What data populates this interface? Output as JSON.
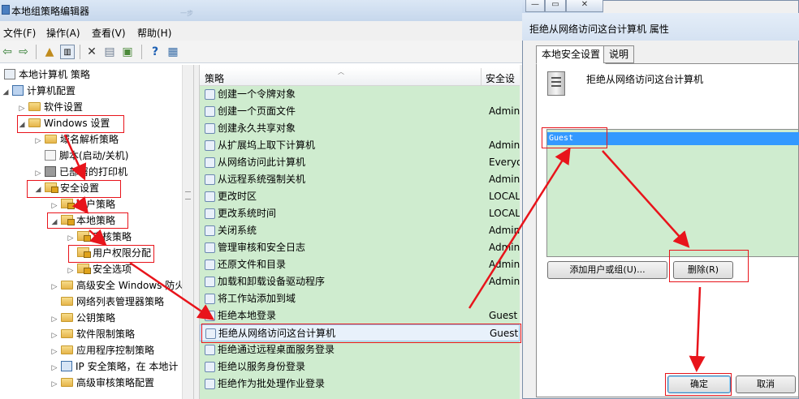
{
  "main_window": {
    "title": "本地组策略编辑器",
    "faded_hint": "一步"
  },
  "menubar": {
    "items": [
      "文件(F)",
      "操作(A)",
      "查看(V)",
      "帮助(H)"
    ]
  },
  "toolbar": {
    "icons": [
      "back-arrow-icon",
      "forward-arrow-icon",
      "up-folder-icon",
      "show-tree-icon",
      "delete-x-icon",
      "properties-icon",
      "export-list-icon",
      "help-icon",
      "extended-view-icon"
    ]
  },
  "tree": {
    "items": [
      {
        "label": "本地计算机 策略",
        "icon": "computer-policy-icon",
        "expand": ""
      },
      {
        "label": "计算机配置",
        "icon": "computer-icon",
        "expand": "open"
      },
      {
        "label": "软件设置",
        "icon": "folder-icon",
        "expand": "closed"
      },
      {
        "label": "Windows 设置",
        "icon": "folder-icon",
        "expand": "open"
      },
      {
        "label": "域名解析策略",
        "icon": "folder-icon",
        "expand": "closed"
      },
      {
        "label": "脚本(启动/关机)",
        "icon": "script-icon",
        "expand": ""
      },
      {
        "label": "已部署的打印机",
        "icon": "printer-icon",
        "expand": "closed"
      },
      {
        "label": "安全设置",
        "icon": "security-folder-icon",
        "expand": "open"
      },
      {
        "label": "帐户策略",
        "icon": "lock-folder-icon",
        "expand": "closed"
      },
      {
        "label": "本地策略",
        "icon": "lock-folder-icon",
        "expand": "open"
      },
      {
        "label": "审核策略",
        "icon": "lock-folder-icon",
        "expand": "closed"
      },
      {
        "label": "用户权限分配",
        "icon": "lock-folder-icon",
        "expand": ""
      },
      {
        "label": "安全选项",
        "icon": "lock-folder-icon",
        "expand": "closed"
      },
      {
        "label": "高级安全 Windows 防火",
        "icon": "folder-icon",
        "expand": "closed"
      },
      {
        "label": "网络列表管理器策略",
        "icon": "folder-icon",
        "expand": ""
      },
      {
        "label": "公钥策略",
        "icon": "folder-icon",
        "expand": "closed"
      },
      {
        "label": "软件限制策略",
        "icon": "folder-icon",
        "expand": "closed"
      },
      {
        "label": "应用程序控制策略",
        "icon": "folder-icon",
        "expand": "closed"
      },
      {
        "label": "IP 安全策略，在 本地计",
        "icon": "ip-security-icon",
        "expand": "closed"
      },
      {
        "label": "高级审核策略配置",
        "icon": "folder-icon",
        "expand": "closed"
      }
    ]
  },
  "list": {
    "col_policy": "策略",
    "col_setting": "安全设置",
    "rows": [
      {
        "name": "创建一个令牌对象",
        "value": ""
      },
      {
        "name": "创建一个页面文件",
        "value": "Adminis"
      },
      {
        "name": "创建永久共享对象",
        "value": ""
      },
      {
        "name": "从扩展坞上取下计算机",
        "value": "Adminis"
      },
      {
        "name": "从网络访问此计算机",
        "value": "Everyon"
      },
      {
        "name": "从远程系统强制关机",
        "value": "Adminis"
      },
      {
        "name": "更改时区",
        "value": "LOCAL S"
      },
      {
        "name": "更改系统时间",
        "value": "LOCAL S"
      },
      {
        "name": "关闭系统",
        "value": "Adminis"
      },
      {
        "name": "管理审核和安全日志",
        "value": "Adminis"
      },
      {
        "name": "还原文件和目录",
        "value": "Adminis"
      },
      {
        "name": "加载和卸载设备驱动程序",
        "value": "Adminis"
      },
      {
        "name": "将工作站添加到域",
        "value": ""
      },
      {
        "name": "拒绝本地登录",
        "value": "Guest"
      },
      {
        "name": "拒绝从网络访问这台计算机",
        "value": "Guest"
      },
      {
        "name": "拒绝通过远程桌面服务登录",
        "value": ""
      },
      {
        "name": "拒绝以服务身份登录",
        "value": ""
      },
      {
        "name": "拒绝作为批处理作业登录",
        "value": ""
      }
    ]
  },
  "dialog": {
    "title": "拒绝从网络访问这台计算机 属性",
    "window_buttons": [
      "minimize-icon",
      "restore-icon",
      "close-icon"
    ],
    "tabs": [
      "本地安全设置",
      "说明"
    ],
    "policy_heading": "拒绝从网络访问这台计算机",
    "accounts": [
      "Guest"
    ],
    "add_button": "添加用户或组(U)...",
    "remove_button": "删除(R)",
    "ok_button": "确定",
    "cancel_button": "取消"
  },
  "colors": {
    "highlight_green": "#cfeccf",
    "annotation_red": "#e8141b",
    "selection_blue": "#3399ff"
  }
}
